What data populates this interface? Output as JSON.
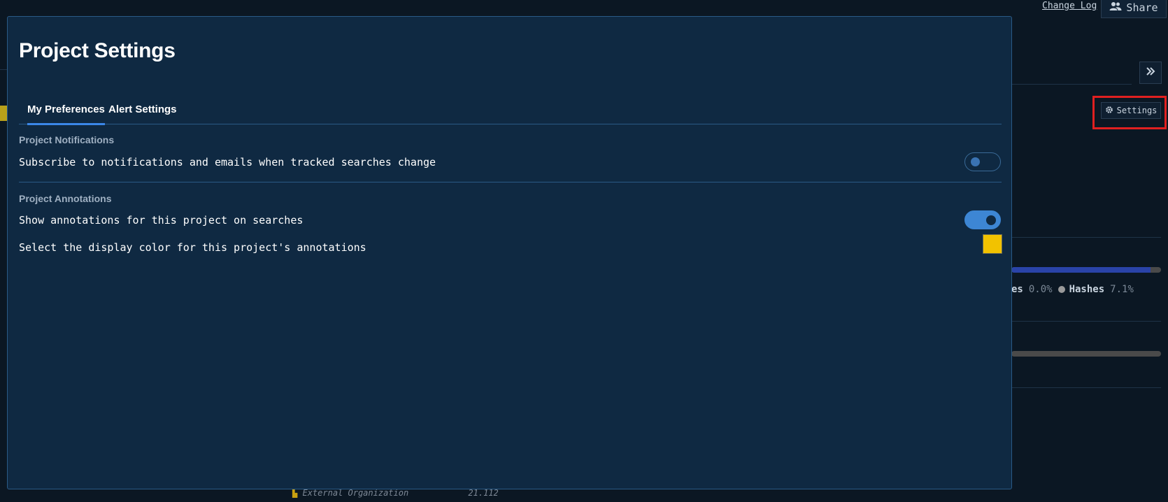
{
  "background": {
    "header": {
      "changelog_label": "Change Log",
      "share_label": "Share",
      "share_icon": "users-icon"
    },
    "expand_icon": "double-chevron-right-icon",
    "settings_button": {
      "label": "Settings",
      "icon": "gear-icon"
    },
    "distribution": {
      "primary_share_percent": 92.9,
      "legend": [
        {
          "label": "es",
          "value": "0.0%"
        },
        {
          "label": "Hashes",
          "value": "7.1%"
        }
      ]
    },
    "table_peek": {
      "label": "External Organization",
      "value": "21.112"
    },
    "highlight_color": "#e02020"
  },
  "modal": {
    "title": "Project Settings",
    "tabs": [
      {
        "label": "My Preferences",
        "active": true
      },
      {
        "label": "Alert Settings",
        "active": false
      }
    ],
    "sections": {
      "notifications": {
        "title": "Project Notifications",
        "subscribe_label": "Subscribe to notifications and emails when tracked searches change",
        "subscribe_enabled": false
      },
      "annotations": {
        "title": "Project Annotations",
        "show_label": "Show annotations for this project on searches",
        "show_enabled": true,
        "color_label": "Select the display color for this project's annotations",
        "color_value": "#f2c200"
      }
    }
  },
  "colors": {
    "modal_bg": "#0f2942",
    "accent": "#3b87e8",
    "toggle_on": "#3d86d4"
  }
}
